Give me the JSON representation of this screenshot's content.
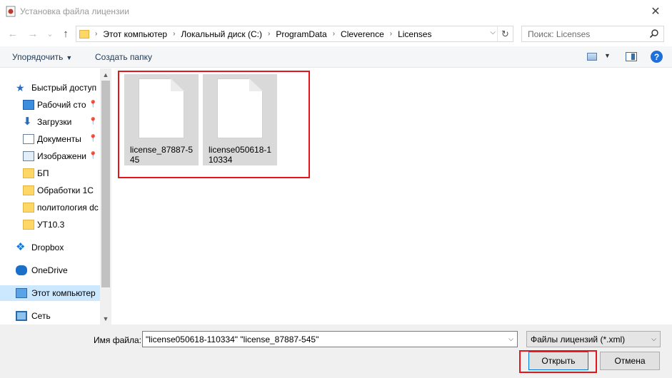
{
  "window": {
    "title": "Установка файла лицензии",
    "close_glyph": "✕"
  },
  "nav": {
    "back_glyph": "←",
    "forward_glyph": "→",
    "recent_glyph": "⌄",
    "up_glyph": "↑",
    "breadcrumbs": [
      "Этот компьютер",
      "Локальный диск (C:)",
      "ProgramData",
      "Cleverence",
      "Licenses"
    ],
    "separator": "›",
    "search_placeholder": "Поиск: Licenses"
  },
  "toolbar": {
    "organize_label": "Упорядочить",
    "new_folder_label": "Создать папку",
    "help_glyph": "?"
  },
  "sidebar": {
    "items": [
      {
        "label": "Быстрый доступ",
        "icon": "star-icon",
        "pinned": false
      },
      {
        "label": "Рабочий сто…",
        "icon": "desktop-icon",
        "pinned": true
      },
      {
        "label": "Загрузки",
        "icon": "downloads-icon",
        "pinned": true
      },
      {
        "label": "Документы",
        "icon": "documents-icon",
        "pinned": true
      },
      {
        "label": "Изображени…",
        "icon": "pictures-icon",
        "pinned": true
      },
      {
        "label": "БП",
        "icon": "folder-icon",
        "pinned": false
      },
      {
        "label": "Обработки 1С",
        "icon": "folder-icon",
        "pinned": false
      },
      {
        "label": "политология dc",
        "icon": "folder-icon",
        "pinned": false
      },
      {
        "label": "УТ10.3",
        "icon": "folder-icon",
        "pinned": false
      },
      {
        "label": "Dropbox",
        "icon": "dropbox-icon",
        "pinned": false
      },
      {
        "label": "OneDrive",
        "icon": "onedrive-icon",
        "pinned": false
      },
      {
        "label": "Этот компьютер",
        "icon": "computer-icon",
        "pinned": false,
        "selected": true
      },
      {
        "label": "Сеть",
        "icon": "network-icon",
        "pinned": false
      }
    ],
    "pin_glyph": "📌"
  },
  "files": [
    {
      "name": "license_87887-545",
      "selected": true
    },
    {
      "name": "license050618-110334",
      "selected": true
    }
  ],
  "bottom": {
    "filename_label": "Имя файла:",
    "filename_value": "\"license050618-110334\" \"license_87887-545\"",
    "filetype_value": "Файлы лицензий (*.xml)",
    "open_label": "Открыть",
    "cancel_label": "Отмена"
  },
  "colors": {
    "highlight": "#e3161c",
    "selection": "#cce8ff",
    "accent": "#0078d7"
  }
}
